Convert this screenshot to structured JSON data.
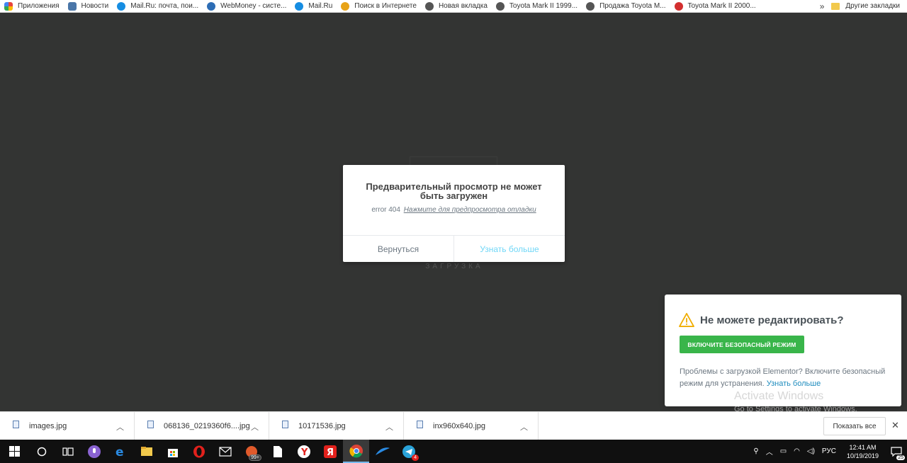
{
  "bookmarks": {
    "items": [
      {
        "label": "Приложения",
        "icon": "apps-grid-icon",
        "color": "#e8453c"
      },
      {
        "label": "Новости",
        "icon": "vk-icon",
        "color": "#4a76a8"
      },
      {
        "label": "Mail.Ru: почта, пои...",
        "icon": "mailru-icon",
        "color": "#168de2"
      },
      {
        "label": "WebMoney - систе...",
        "icon": "webmoney-icon",
        "color": "#2d6db5"
      },
      {
        "label": "Mail.Ru",
        "icon": "mailru-icon",
        "color": "#168de2"
      },
      {
        "label": "Поиск в Интернете",
        "icon": "key-search-icon",
        "color": "#e8a317"
      },
      {
        "label": "Новая вкладка",
        "icon": "globe-icon",
        "color": "#555555"
      },
      {
        "label": "Toyota Mark II 1999...",
        "icon": "globe-icon",
        "color": "#555555"
      },
      {
        "label": "Продажа Toyota M...",
        "icon": "globe-icon",
        "color": "#555555"
      },
      {
        "label": "Toyota Mark II 2000...",
        "icon": "drom-icon",
        "color": "#d32f2f"
      }
    ],
    "more": "»",
    "other": "Другие закладки"
  },
  "page": {
    "loading_text": "ЗАГРУЗКА"
  },
  "modal": {
    "title": "Предварительный просмотр не может быть загружен",
    "error_code": "error 404",
    "debug_link": "Нажмите для предпросмотра отладки",
    "back_button": "Вернуться",
    "learn_button": "Узнать больше"
  },
  "notice": {
    "title": "Не можете редактировать?",
    "safe_mode_button": "ВКЛЮЧИТЕ БЕЗОПАСНЫЙ РЕЖИМ",
    "text": "Проблемы с загрузкой Elementor? Включите безопасный режим для устранения.",
    "link": "Узнать больше"
  },
  "watermark": {
    "title": "Activate Windows",
    "subtitle": "Go to Settings to activate Windows."
  },
  "downloads": {
    "items": [
      {
        "name": "images.jpg"
      },
      {
        "name": "068136_0219360f6....jpg"
      },
      {
        "name": "10171536.jpg"
      },
      {
        "name": "inx960x640.jpg"
      }
    ],
    "show_all": "Показать все",
    "close": "✕"
  },
  "taskbar": {
    "mail_badge": "99+",
    "telegram_badge": "4",
    "language": "РУС",
    "time": "12:41 AM",
    "date": "10/19/2019",
    "notifications": "25"
  }
}
